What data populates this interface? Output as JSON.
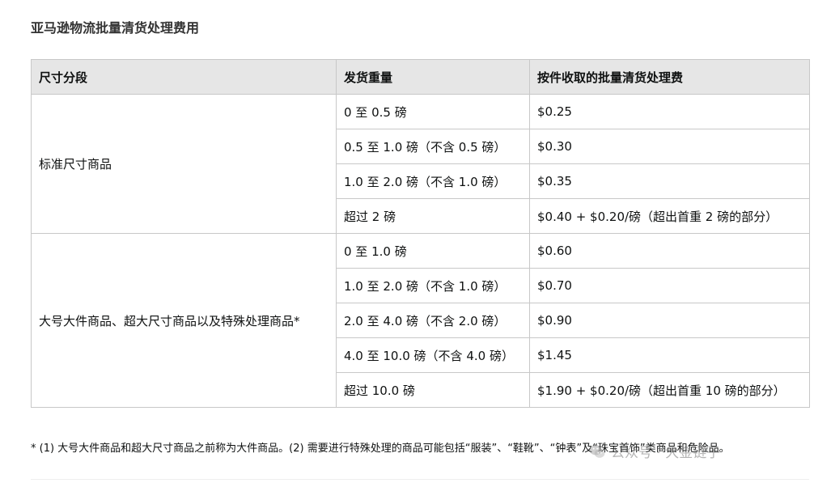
{
  "title": "亚马逊物流批量清货处理费用",
  "table": {
    "headers": [
      "尺寸分段",
      "发货重量",
      "按件收取的批量清货处理费"
    ],
    "groups": [
      {
        "tier": "标准尺寸商品",
        "rows": [
          {
            "weight": "0 至 0.5 磅",
            "fee": "$0.25"
          },
          {
            "weight": "0.5 至 1.0 磅（不含 0.5 磅）",
            "fee": "$0.30"
          },
          {
            "weight": "1.0 至 2.0 磅（不含 1.0 磅）",
            "fee": "$0.35"
          },
          {
            "weight": "超过 2 磅",
            "fee": "$0.40 + $0.20/磅（超出首重 2 磅的部分）"
          }
        ]
      },
      {
        "tier": "大号大件商品、超大尺寸商品以及特殊处理商品*",
        "rows": [
          {
            "weight": "0 至 1.0 磅",
            "fee": "$0.60"
          },
          {
            "weight": "1.0 至 2.0 磅（不含 1.0 磅）",
            "fee": "$0.70"
          },
          {
            "weight": "2.0 至 4.0 磅（不含 2.0 磅）",
            "fee": "$0.90"
          },
          {
            "weight": "4.0 至 10.0 磅（不含 4.0 磅）",
            "fee": "$1.45"
          },
          {
            "weight": "超过 10.0 磅",
            "fee": "$1.90 + $0.20/磅（超出首重 10 磅的部分）"
          }
        ]
      }
    ]
  },
  "footnote": "* (1) 大号大件商品和超大尺寸商品之前称为大件商品。(2) 需要进行特殊处理的商品可能包括“服装”、“鞋靴”、“钟表”及“珠宝首饰”类商品和危险品。",
  "watermark": {
    "text": "公众号 · 大金链子",
    "icon": "wechat-icon"
  }
}
